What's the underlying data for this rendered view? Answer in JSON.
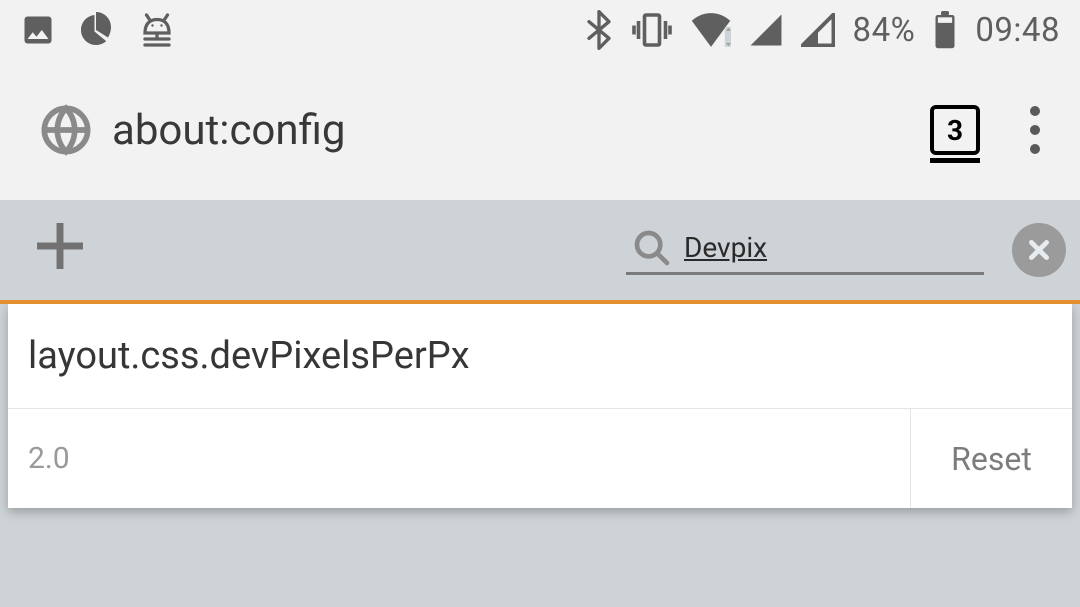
{
  "status": {
    "battery_pct": "84%",
    "time": "09:48"
  },
  "browser": {
    "url": "about:config",
    "tab_count": "3"
  },
  "toolbar": {
    "search_value": "Devpix"
  },
  "result": {
    "pref_name": "layout.css.devPixelsPerPx",
    "pref_value": "2.0",
    "reset_label": "Reset"
  }
}
